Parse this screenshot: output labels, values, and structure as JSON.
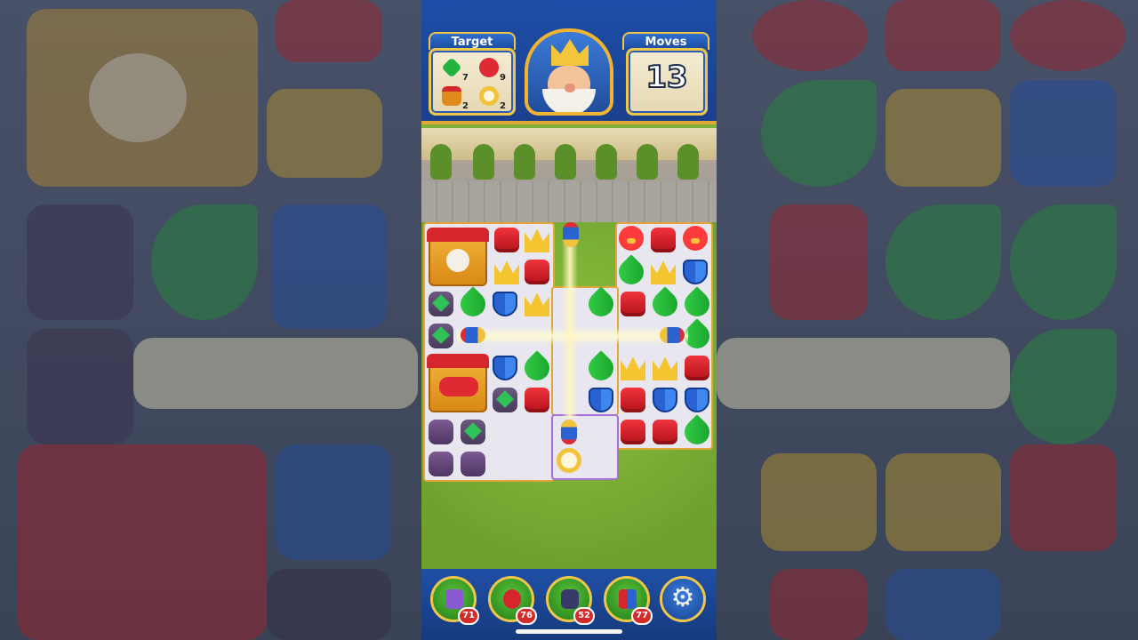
{
  "hud": {
    "target_label": "Target",
    "moves_label": "Moves",
    "moves_remaining": "13",
    "targets": [
      {
        "icon": "green-gem-icon",
        "count": "7"
      },
      {
        "icon": "red-bird-icon",
        "count": "9"
      },
      {
        "icon": "bird-house-icon",
        "count": "2"
      },
      {
        "icon": "gold-ring-icon",
        "count": "2"
      }
    ]
  },
  "boosters": [
    {
      "icon": "hammer-icon",
      "count": "71"
    },
    {
      "icon": "arrow-icon",
      "count": "76"
    },
    {
      "icon": "cannon-icon",
      "count": "52"
    },
    {
      "icon": "jester-hat-icon",
      "count": "77"
    }
  ],
  "settings_icon": "gear-icon",
  "colors": {
    "red": "#e02a33",
    "blue": "#2a62d1",
    "green": "#22b43a",
    "yellow": "#f4c431",
    "hud_blue": "#1d4fa8",
    "gold_border": "#f0c64a"
  }
}
